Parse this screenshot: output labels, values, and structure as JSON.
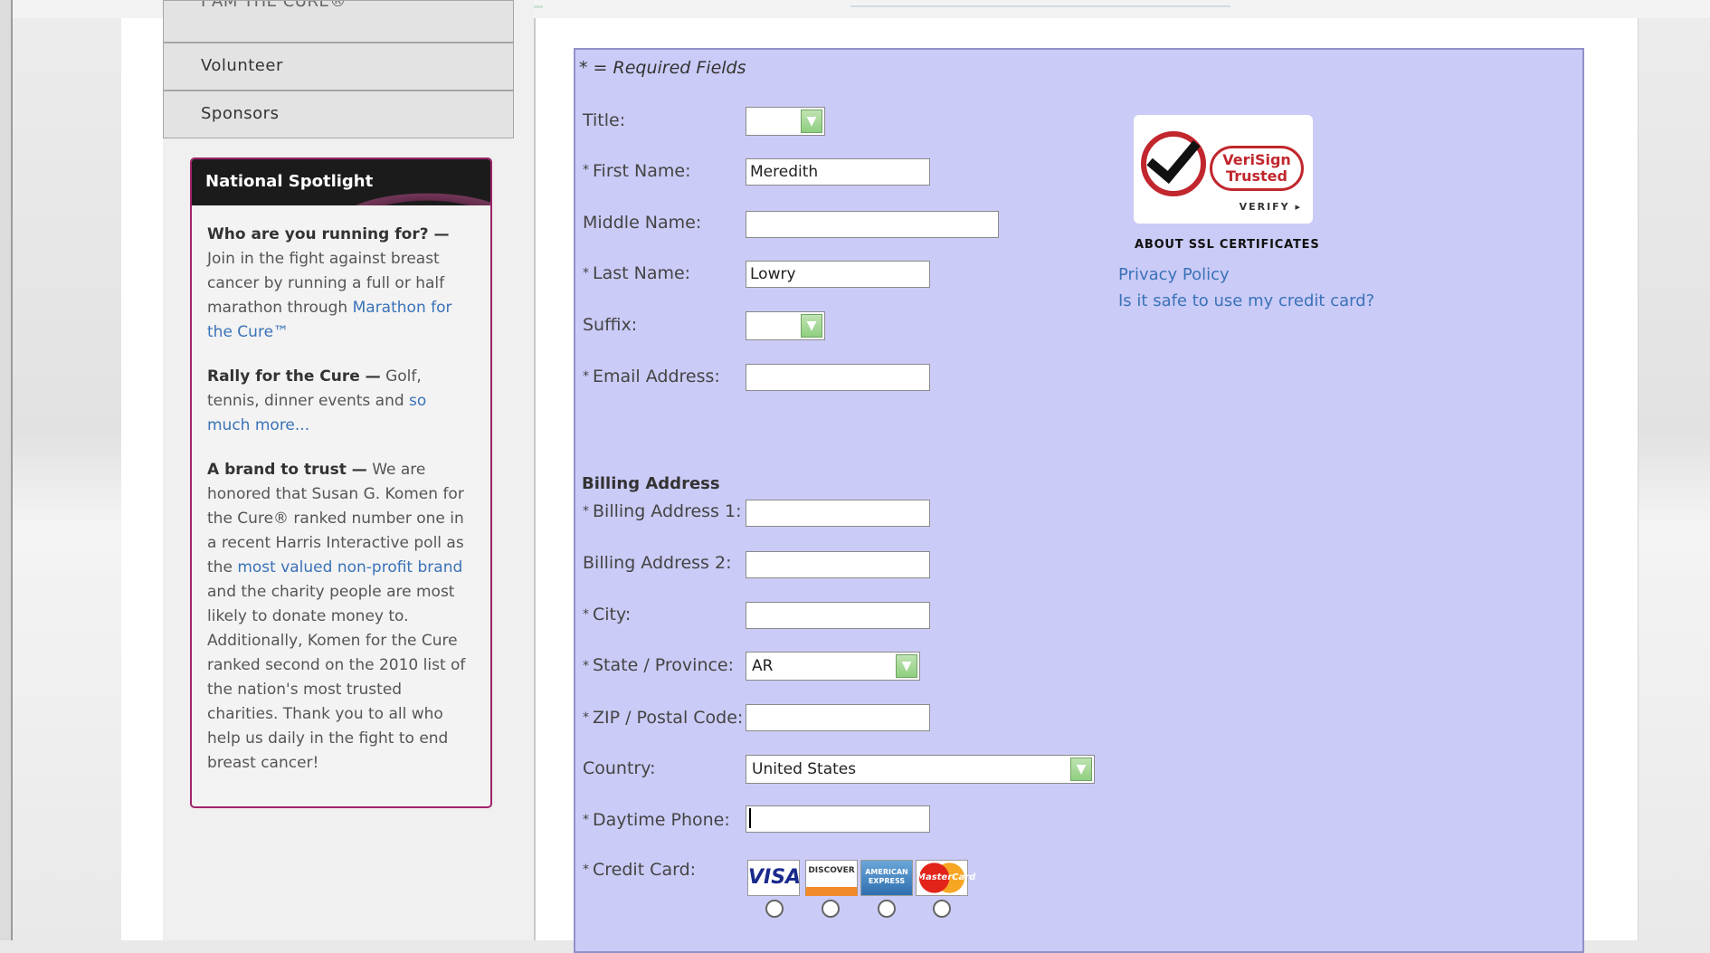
{
  "nav": {
    "items": [
      {
        "label": "I AM THE CURE®"
      },
      {
        "label": "Volunteer"
      },
      {
        "label": "Sponsors"
      }
    ]
  },
  "spotlight": {
    "heading": "National Spotlight",
    "p1": {
      "bold": "Who are you running for? —",
      "text": " Join in the fight against breast cancer by running a full or half marathon through ",
      "link": "Marathon for the Cure™"
    },
    "p2": {
      "bold": "Rally for the Cure —",
      "text": " Golf, tennis, dinner events and ",
      "link": "so much more..."
    },
    "p3": {
      "bold": "A brand to trust —",
      "text1": " We are honored that Susan G. Komen for the Cure® ranked number one in a recent Harris Interactive poll as the ",
      "link": "most valued non-profit brand",
      "text2": " and the charity people are most likely to donate money to. Additionally, Komen for the Cure ranked second on the 2010 list of the nation's most trusted charities. Thank you to all who help us daily in the fight to end breast cancer!"
    }
  },
  "form": {
    "required_note": "* = Required Fields",
    "title_label": "Title:",
    "title_value": "",
    "first_label": "First Name:",
    "first_value": "Meredith",
    "middle_label": "Middle Name:",
    "middle_value": "",
    "last_label": "Last Name:",
    "last_value": "Lowry",
    "suffix_label": "Suffix:",
    "suffix_value": "",
    "email_label": "Email Address:",
    "email_value": "",
    "billing_heading": "Billing Address",
    "addr1_label": "Billing Address 1:",
    "addr2_label": "Billing Address 2:",
    "city_label": "City:",
    "state_label": "State / Province:",
    "state_value": "AR",
    "zip_label": "ZIP / Postal Code:",
    "country_label": "Country:",
    "country_value": "United States",
    "phone_label": "Daytime Phone:",
    "cc_label": "Credit Card:",
    "star": "*",
    "cards": [
      "VISA",
      "DISCOVER",
      "AMERICAN EXPRESS",
      "MasterCard"
    ]
  },
  "trust": {
    "verisign_line1": "VeriSign",
    "verisign_line2": "Trusted",
    "verify": "VERIFY ▸",
    "ssl": "ABOUT SSL CERTIFICATES",
    "privacy": "Privacy Policy",
    "safe": "Is it safe to use my credit card?"
  },
  "colors": {
    "form_bg": "#cbcbf7",
    "accent": "#a0236a",
    "link": "#3a72b8"
  }
}
